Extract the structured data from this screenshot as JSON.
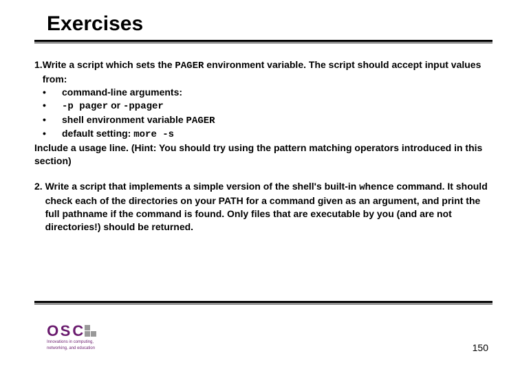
{
  "title": "Exercises",
  "ex1": {
    "lead": "1.",
    "intro_a": "Write a script which sets the ",
    "intro_code": "PAGER",
    "intro_b": " environment variable. The script should accept input values from:",
    "b1": "command-line arguments:",
    "b2_a": "-p pager",
    "b2_mid": " or ",
    "b2_b": "-ppager",
    "b3_a": "shell environment variable ",
    "b3_code": "PAGER",
    "b4_a": "default setting: ",
    "b4_code": "more -s",
    "tail": "Include a usage line. (Hint: You should try using the pattern matching operators introduced in this section)"
  },
  "ex2": {
    "lead": "2. ",
    "a": "Write a script that implements a simple version of the shell's built-in ",
    "code": "whence",
    "b": " command. It should check each of the directories on your PATH for a command given as an argument, and print the full pathname if the command is found. Only files that are executable by you (and are not directories!) should be returned."
  },
  "logo": {
    "o": "O",
    "s": "S",
    "c": "C",
    "tag1": "Innovations in computing,",
    "tag2": "networking, and education"
  },
  "page": "150"
}
